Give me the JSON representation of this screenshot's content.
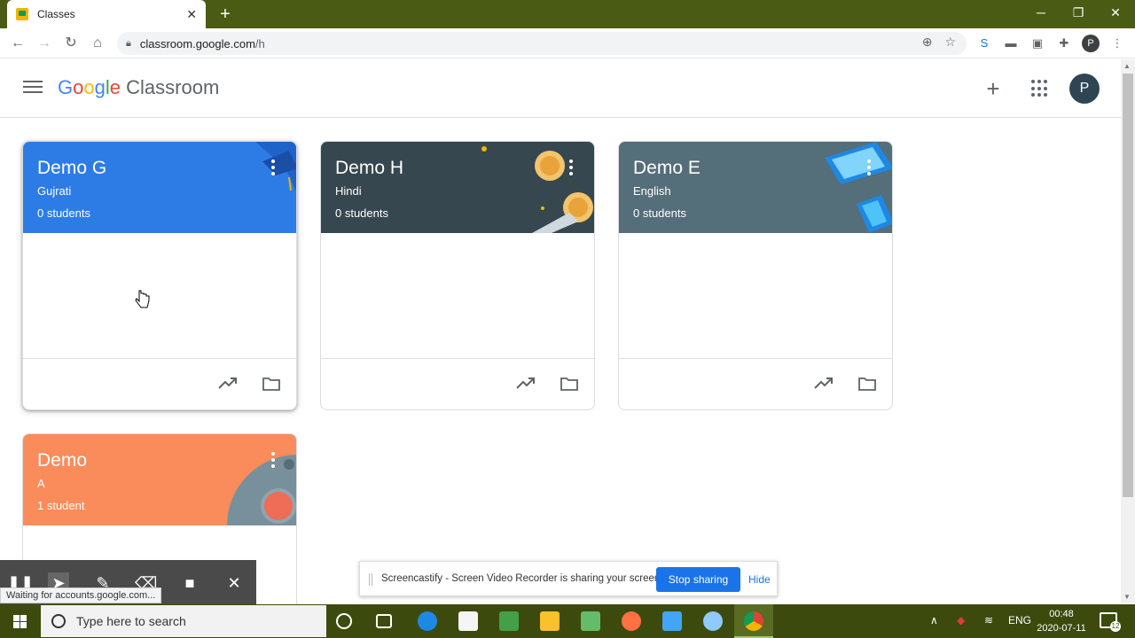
{
  "browser": {
    "tab_title": "Classes",
    "tab_close": "✕",
    "new_tab": "+",
    "url_host": "classroom.google.com",
    "url_path": "/h",
    "profile_initial": "P"
  },
  "app": {
    "logo_google": [
      "G",
      "o",
      "o",
      "g",
      "l",
      "e"
    ],
    "logo_product": "Classroom",
    "avatar_initial": "P"
  },
  "classes": [
    {
      "title": "Demo G",
      "section": "Gujrati",
      "students": "0 students",
      "color": "#2d7ce6"
    },
    {
      "title": "Demo H",
      "section": "Hindi",
      "students": "0 students",
      "color": "#37474f"
    },
    {
      "title": "Demo E",
      "section": "English",
      "students": "0 students",
      "color": "#546e7a"
    },
    {
      "title": "Demo",
      "section": "A",
      "students": "1 student",
      "color": "#f98c5a"
    }
  ],
  "screencastify": {
    "message": "Screencastify - Screen Video Recorder is sharing your screen.",
    "stop_label": "Stop sharing",
    "hide_label": "Hide"
  },
  "status_text": "Waiting for accounts.google.com...",
  "taskbar": {
    "search_placeholder": "Type here to search",
    "language": "ENG",
    "time": "00:48",
    "date": "2020-07-11",
    "notification_count": "12"
  }
}
